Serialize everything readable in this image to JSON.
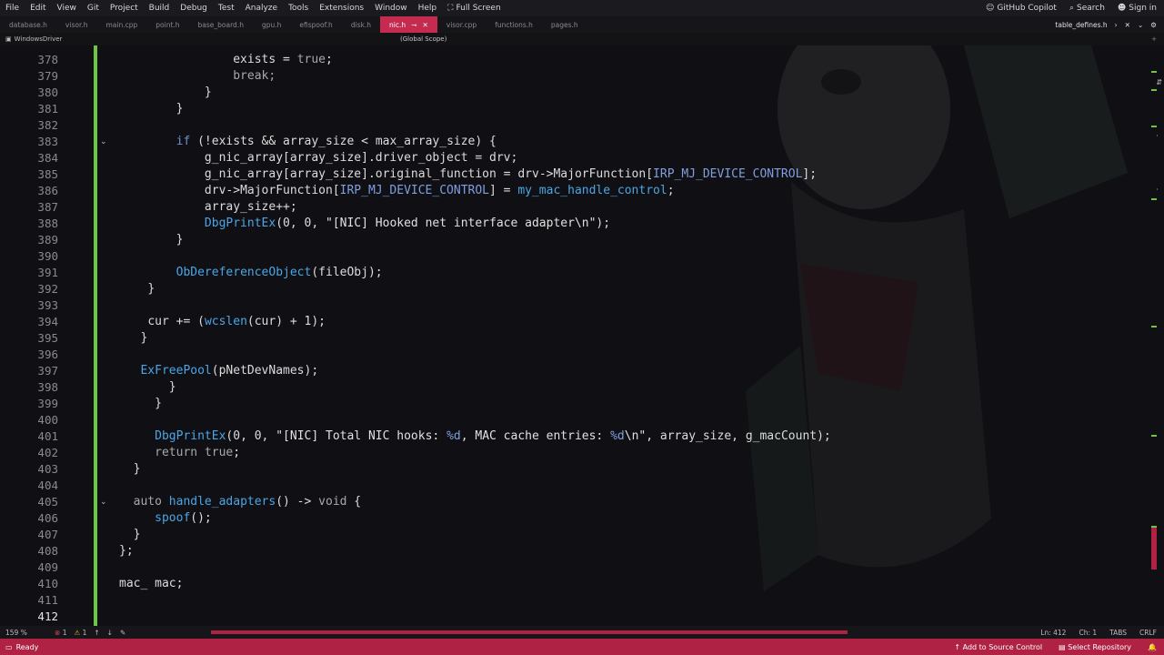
{
  "menu": {
    "items": [
      "File",
      "Edit",
      "View",
      "Git",
      "Project",
      "Build",
      "Debug",
      "Test",
      "Analyze",
      "Tools",
      "Extensions",
      "Window",
      "Help"
    ],
    "fullscreen": "Full Screen",
    "copilot": "GitHub Copilot",
    "search": "Search",
    "signin": "Sign in"
  },
  "tabs": {
    "items": [
      "database.h",
      "visor.h",
      "main.cpp",
      "point.h",
      "base_board.h",
      "gpu.h",
      "efispoof.h",
      "disk.h"
    ],
    "active": "nic.h",
    "after": [
      "visor.cpp",
      "functions.h",
      "pages.h"
    ],
    "right_file": "table_defines.h"
  },
  "nav": {
    "project": "WindowsDriver",
    "scope": "(Global Scope)"
  },
  "editor": {
    "lines": [
      {
        "n": "378",
        "y": 0
      },
      {
        "n": "379"
      },
      {
        "n": "380"
      },
      {
        "n": "381"
      },
      {
        "n": "382"
      },
      {
        "n": "383"
      },
      {
        "n": "384"
      },
      {
        "n": "385"
      },
      {
        "n": "386"
      },
      {
        "n": "387"
      },
      {
        "n": "388"
      },
      {
        "n": "389"
      },
      {
        "n": "390"
      },
      {
        "n": "391"
      },
      {
        "n": "392"
      },
      {
        "n": "393"
      },
      {
        "n": "394"
      },
      {
        "n": "395"
      },
      {
        "n": "396"
      },
      {
        "n": "397"
      },
      {
        "n": "398"
      },
      {
        "n": "399"
      },
      {
        "n": "400"
      },
      {
        "n": "401"
      },
      {
        "n": "402"
      },
      {
        "n": "403"
      },
      {
        "n": "404"
      },
      {
        "n": "405"
      },
      {
        "n": "406"
      },
      {
        "n": "407"
      },
      {
        "n": "408"
      },
      {
        "n": "409"
      },
      {
        "n": "410"
      },
      {
        "n": "411"
      },
      {
        "n": "412"
      }
    ],
    "code": {
      "l378a": "exists",
      "l378b": " = ",
      "l378c": "true",
      "l378d": ";",
      "l379": "break;",
      "l380": "}",
      "l381": "}",
      "l383a": "if",
      "l383b": " (!",
      "l383c": "exists",
      "l383d": " && ",
      "l383e": "array_size",
      "l383f": " < ",
      "l383g": "max_array_size",
      "l383h": ") {",
      "l384a": "g_nic_array",
      "l384b": "[",
      "l384c": "array_size",
      "l384d": "].",
      "l384e": "driver_object",
      "l384f": " = ",
      "l384g": "drv",
      "l384h": ";",
      "l385a": "g_nic_array",
      "l385b": "[",
      "l385c": "array_size",
      "l385d": "].",
      "l385e": "original_function",
      "l385f": " = ",
      "l385g": "drv",
      "l385h": "->",
      "l385i": "MajorFunction",
      "l385j": "[",
      "l385k": "IRP_MJ_DEVICE_CONTROL",
      "l385l": "];",
      "l386a": "drv",
      "l386b": "->",
      "l386c": "MajorFunction",
      "l386d": "[",
      "l386e": "IRP_MJ_DEVICE_CONTROL",
      "l386f": "] = ",
      "l386g": "my_mac_handle_control",
      "l386h": ";",
      "l387a": "array_size",
      "l387b": "++;",
      "l388a": "DbgPrintEx",
      "l388b": "(0, 0, ",
      "l388c": "\"[NIC] Hooked net interface adapter\\n\"",
      "l388d": ");",
      "l389": "}",
      "l391a": "ObDereferenceObject",
      "l391b": "(",
      "l391c": "fileObj",
      "l391d": ");",
      "l392": "}",
      "l394a": "cur",
      "l394b": " += (",
      "l394c": "wcslen",
      "l394d": "(",
      "l394e": "cur",
      "l394f": ") + 1);",
      "l395": "}",
      "l397a": "ExFreePool",
      "l397b": "(",
      "l397c": "pNetDevNames",
      "l397d": ");",
      "l398": "}",
      "l399": "}",
      "l401a": "DbgPrintEx",
      "l401b": "(0, 0, ",
      "l401c": "\"[NIC] Total NIC hooks: ",
      "l401d": "%d",
      "l401e": ", MAC cache entries: ",
      "l401f": "%d",
      "l401g": "\\n\"",
      "l401h": ", ",
      "l401i": "array_size",
      "l401j": ", ",
      "l401k": "g_macCount",
      "l401l": ");",
      "l402a": "return",
      "l402b": " ",
      "l402c": "true",
      "l402d": ";",
      "l403": "}",
      "l405a": "auto",
      "l405b": " ",
      "l405c": "handle_adapters",
      "l405d": "() -> ",
      "l405e": "void",
      "l405f": " {",
      "l406a": "spoof",
      "l406b": "();",
      "l407": "}",
      "l408": "};",
      "l410a": "mac_",
      "l410b": " ",
      "l410c": "mac",
      "l410d": ";"
    }
  },
  "edstatus": {
    "zoom": "159 %",
    "errors": "1",
    "warnings": "1",
    "ln": "Ln: 412",
    "ch": "Ch: 1",
    "tabs": "TABS",
    "crlf": "CRLF"
  },
  "statusbar": {
    "ready": "Ready",
    "source_control": "Add to Source Control",
    "repo": "Select Repository"
  },
  "colors": {
    "accent": "#b02243",
    "active_tab": "#c42b4f",
    "change_bar": "#6ec443"
  }
}
